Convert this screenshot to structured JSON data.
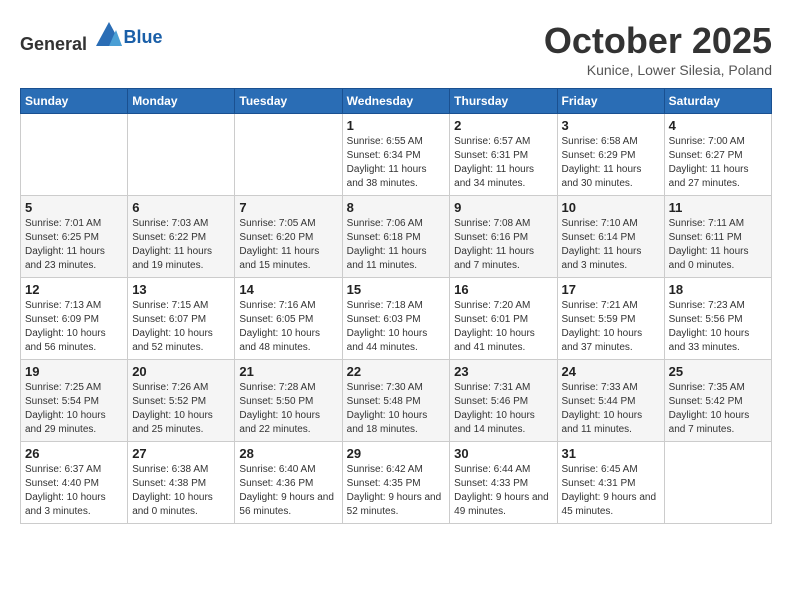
{
  "header": {
    "logo": {
      "general": "General",
      "blue": "Blue"
    },
    "title": "October 2025",
    "location": "Kunice, Lower Silesia, Poland"
  },
  "calendar": {
    "weekdays": [
      "Sunday",
      "Monday",
      "Tuesday",
      "Wednesday",
      "Thursday",
      "Friday",
      "Saturday"
    ],
    "weeks": [
      [
        {
          "day": null
        },
        {
          "day": null
        },
        {
          "day": null
        },
        {
          "day": 1,
          "sunrise": "6:55 AM",
          "sunset": "6:34 PM",
          "daylight": "11 hours and 38 minutes."
        },
        {
          "day": 2,
          "sunrise": "6:57 AM",
          "sunset": "6:31 PM",
          "daylight": "11 hours and 34 minutes."
        },
        {
          "day": 3,
          "sunrise": "6:58 AM",
          "sunset": "6:29 PM",
          "daylight": "11 hours and 30 minutes."
        },
        {
          "day": 4,
          "sunrise": "7:00 AM",
          "sunset": "6:27 PM",
          "daylight": "11 hours and 27 minutes."
        }
      ],
      [
        {
          "day": 5,
          "sunrise": "7:01 AM",
          "sunset": "6:25 PM",
          "daylight": "11 hours and 23 minutes."
        },
        {
          "day": 6,
          "sunrise": "7:03 AM",
          "sunset": "6:22 PM",
          "daylight": "11 hours and 19 minutes."
        },
        {
          "day": 7,
          "sunrise": "7:05 AM",
          "sunset": "6:20 PM",
          "daylight": "11 hours and 15 minutes."
        },
        {
          "day": 8,
          "sunrise": "7:06 AM",
          "sunset": "6:18 PM",
          "daylight": "11 hours and 11 minutes."
        },
        {
          "day": 9,
          "sunrise": "7:08 AM",
          "sunset": "6:16 PM",
          "daylight": "11 hours and 7 minutes."
        },
        {
          "day": 10,
          "sunrise": "7:10 AM",
          "sunset": "6:14 PM",
          "daylight": "11 hours and 3 minutes."
        },
        {
          "day": 11,
          "sunrise": "7:11 AM",
          "sunset": "6:11 PM",
          "daylight": "11 hours and 0 minutes."
        }
      ],
      [
        {
          "day": 12,
          "sunrise": "7:13 AM",
          "sunset": "6:09 PM",
          "daylight": "10 hours and 56 minutes."
        },
        {
          "day": 13,
          "sunrise": "7:15 AM",
          "sunset": "6:07 PM",
          "daylight": "10 hours and 52 minutes."
        },
        {
          "day": 14,
          "sunrise": "7:16 AM",
          "sunset": "6:05 PM",
          "daylight": "10 hours and 48 minutes."
        },
        {
          "day": 15,
          "sunrise": "7:18 AM",
          "sunset": "6:03 PM",
          "daylight": "10 hours and 44 minutes."
        },
        {
          "day": 16,
          "sunrise": "7:20 AM",
          "sunset": "6:01 PM",
          "daylight": "10 hours and 41 minutes."
        },
        {
          "day": 17,
          "sunrise": "7:21 AM",
          "sunset": "5:59 PM",
          "daylight": "10 hours and 37 minutes."
        },
        {
          "day": 18,
          "sunrise": "7:23 AM",
          "sunset": "5:56 PM",
          "daylight": "10 hours and 33 minutes."
        }
      ],
      [
        {
          "day": 19,
          "sunrise": "7:25 AM",
          "sunset": "5:54 PM",
          "daylight": "10 hours and 29 minutes."
        },
        {
          "day": 20,
          "sunrise": "7:26 AM",
          "sunset": "5:52 PM",
          "daylight": "10 hours and 25 minutes."
        },
        {
          "day": 21,
          "sunrise": "7:28 AM",
          "sunset": "5:50 PM",
          "daylight": "10 hours and 22 minutes."
        },
        {
          "day": 22,
          "sunrise": "7:30 AM",
          "sunset": "5:48 PM",
          "daylight": "10 hours and 18 minutes."
        },
        {
          "day": 23,
          "sunrise": "7:31 AM",
          "sunset": "5:46 PM",
          "daylight": "10 hours and 14 minutes."
        },
        {
          "day": 24,
          "sunrise": "7:33 AM",
          "sunset": "5:44 PM",
          "daylight": "10 hours and 11 minutes."
        },
        {
          "day": 25,
          "sunrise": "7:35 AM",
          "sunset": "5:42 PM",
          "daylight": "10 hours and 7 minutes."
        }
      ],
      [
        {
          "day": 26,
          "sunrise": "6:37 AM",
          "sunset": "4:40 PM",
          "daylight": "10 hours and 3 minutes."
        },
        {
          "day": 27,
          "sunrise": "6:38 AM",
          "sunset": "4:38 PM",
          "daylight": "10 hours and 0 minutes."
        },
        {
          "day": 28,
          "sunrise": "6:40 AM",
          "sunset": "4:36 PM",
          "daylight": "9 hours and 56 minutes."
        },
        {
          "day": 29,
          "sunrise": "6:42 AM",
          "sunset": "4:35 PM",
          "daylight": "9 hours and 52 minutes."
        },
        {
          "day": 30,
          "sunrise": "6:44 AM",
          "sunset": "4:33 PM",
          "daylight": "9 hours and 49 minutes."
        },
        {
          "day": 31,
          "sunrise": "6:45 AM",
          "sunset": "4:31 PM",
          "daylight": "9 hours and 45 minutes."
        },
        {
          "day": null
        }
      ]
    ]
  }
}
